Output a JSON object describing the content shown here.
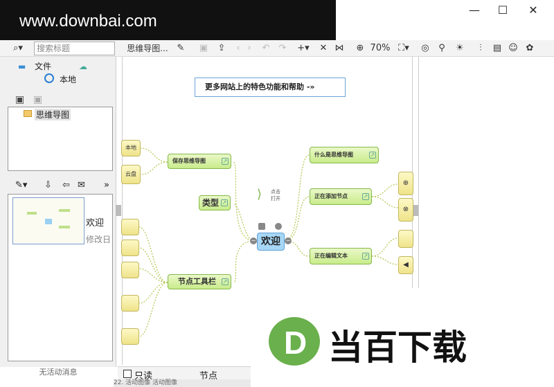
{
  "watermark_top": "www.downbai.com",
  "window_controls": {
    "minimize": "—",
    "maximize": "☐",
    "close": "✕"
  },
  "toolbar": {
    "search_placeholder": "搜索标题",
    "doc_title": "思维导图...",
    "zoom": "70%"
  },
  "left": {
    "tab_file": "文件",
    "local": "本地",
    "tree_item": "思维导图",
    "thumb_title": "欢迎",
    "thumb_date": "修改日",
    "status": "无活动消息"
  },
  "canvas": {
    "banner": "更多网站上的特色功能和帮助 -»",
    "center": "欢迎",
    "left_nodes": {
      "save": "保存思维导图",
      "type": "类型",
      "node_toolbar": "节点工具栏"
    },
    "leaf_local": "本地",
    "leaf_cloud": "云盘",
    "right_nodes": {
      "what": "什么是思维导图",
      "add_node": "正在添加节点",
      "edit_text": "正在编辑文本"
    },
    "click_hint_1": "点击",
    "click_hint_2": "打开"
  },
  "bottom": {
    "readonly": "只读",
    "node": "节点",
    "statusline": "22. 活动图像  活动图像"
  },
  "watermark_bottom": {
    "brand": "当百下载",
    "logo_letter": "D"
  },
  "colors": {
    "accent_green": "#6ab04c",
    "node_yellow": "#efe38a",
    "node_green": "#c9ec8b"
  }
}
